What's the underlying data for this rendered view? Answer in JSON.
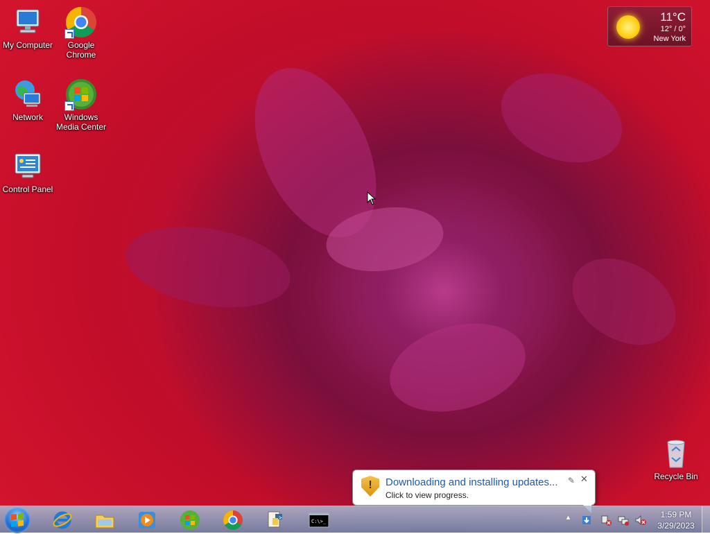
{
  "desktop": {
    "icons": [
      {
        "label": "My Computer"
      },
      {
        "label": "Google Chrome"
      },
      {
        "label": "Network"
      },
      {
        "label": "Windows Media Center"
      },
      {
        "label": "Control Panel"
      },
      {
        "label": "Recycle Bin"
      }
    ]
  },
  "weather": {
    "temperature": "11°C",
    "range": "12° / 0°",
    "city": "New York",
    "icon": "sun-icon"
  },
  "notification": {
    "title": "Downloading and installing updates...",
    "subtitle": "Click to view progress.",
    "icon": "shield-warning-icon",
    "pin_glyph": "✎",
    "close_glyph": "✕"
  },
  "taskbar": {
    "pinned": [
      {
        "name": "internet-explorer"
      },
      {
        "name": "windows-explorer"
      },
      {
        "name": "windows-media-player"
      },
      {
        "name": "windows-media-center"
      },
      {
        "name": "google-chrome"
      },
      {
        "name": "python"
      },
      {
        "name": "command-prompt",
        "text": "C:\\>_"
      }
    ],
    "tray": {
      "show_hidden_glyph": "▲"
    },
    "clock": {
      "time": "1:59 PM",
      "date": "3/29/2023"
    }
  },
  "colors": {
    "accent": "#1e5aa8",
    "wallpaper_red": "#c3102a",
    "wallpaper_magenta": "#9a1f5f"
  }
}
